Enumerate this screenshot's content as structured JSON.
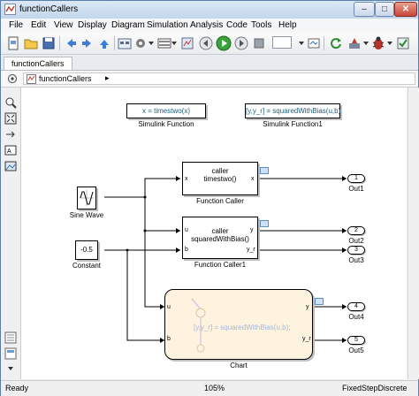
{
  "window": {
    "title": "functionCallers",
    "minimize": "–",
    "maximize": "□",
    "close": "✕"
  },
  "menu": [
    "File",
    "Edit",
    "View",
    "Display",
    "Diagram",
    "Simulation",
    "Analysis",
    "Code",
    "Tools",
    "Help"
  ],
  "toolbar": {
    "zoom_combo": "",
    "icons": [
      "new-model-icon",
      "open-icon",
      "save-icon",
      "back-icon",
      "forward-icon",
      "up-icon",
      "model-config-icon",
      "library-browser-icon",
      "explorer-icon",
      "step-back-icon",
      "run-icon",
      "step-forward-icon",
      "stop-icon",
      "stop-time-combo",
      "mode-icon",
      "refresh-icon",
      "build-icon",
      "debug-icon"
    ]
  },
  "tabs": [
    "functionCallers"
  ],
  "breadcrumb": {
    "path": "functionCallers",
    "arrow": "▸"
  },
  "blocks": {
    "simulink_function": {
      "code": "x = timestwo(x)",
      "label": "Simulink Function"
    },
    "simulink_function1": {
      "code": "[y,y_r] = squaredWithBias(u,b)",
      "label": "Simulink Function1"
    },
    "function_caller": {
      "line1": "caller",
      "line2": "timestwo()",
      "in": "x",
      "out": "x",
      "label": "Function Caller"
    },
    "function_caller1": {
      "line1": "caller",
      "line2": "squaredWithBias()",
      "in1": "u",
      "in2": "b",
      "out1": "y",
      "out2": "y_r",
      "label": "Function Caller1"
    },
    "sine_wave": {
      "label": "Sine Wave"
    },
    "constant": {
      "value": "-0.5",
      "label": "Constant"
    },
    "chart": {
      "code": "[y,y_r] = squaredWithBias(u,b);",
      "in1": "u",
      "in2": "b",
      "out1": "y",
      "out2": "y_r",
      "label": "Chart"
    },
    "outports": [
      {
        "num": "1",
        "label": "Out1"
      },
      {
        "num": "2",
        "label": "Out2"
      },
      {
        "num": "3",
        "label": "Out3"
      },
      {
        "num": "4",
        "label": "Out4"
      },
      {
        "num": "5",
        "label": "Out5"
      }
    ]
  },
  "status": {
    "left": "Ready",
    "zoom": "105%",
    "solver": "FixedStepDiscrete"
  }
}
